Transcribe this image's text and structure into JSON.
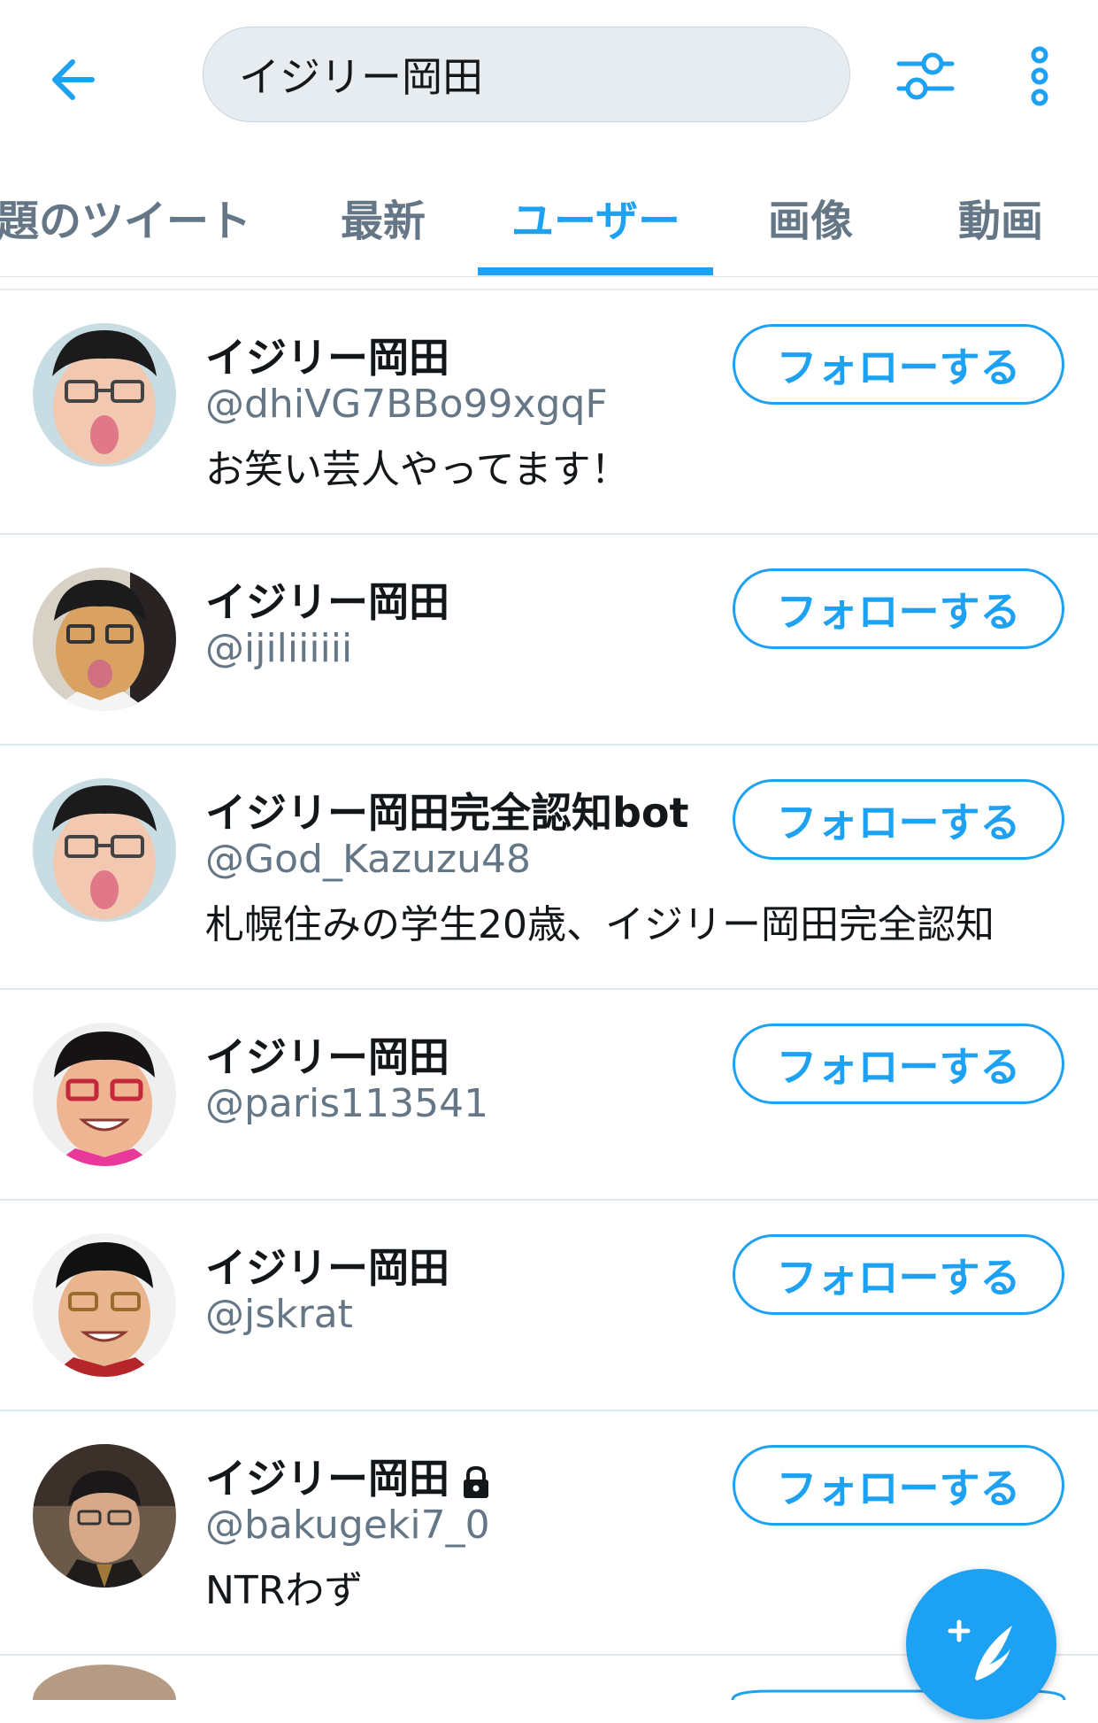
{
  "search": {
    "query": "イジリー岡田"
  },
  "icons": {
    "back": "arrow-left-icon",
    "filter": "sliders-icon",
    "more": "vertical-dots-icon",
    "compose": "compose-tweet-icon",
    "lock": "lock-icon"
  },
  "colors": {
    "accent": "#1da1f2",
    "secondary_text": "#657786",
    "divider": "#e1e8ed"
  },
  "tabs": [
    {
      "label": "題のツイート",
      "active": false
    },
    {
      "label": "最新",
      "active": false
    },
    {
      "label": "ユーザー",
      "active": true
    },
    {
      "label": "画像",
      "active": false
    },
    {
      "label": "動画",
      "active": false
    }
  ],
  "users": [
    {
      "name": "イジリー岡田",
      "handle": "@dhiVG7BBo99xgqF",
      "bio": "お笑い芸人やってます！",
      "follow_label": "フォローする",
      "protected": false
    },
    {
      "name": "イジリー岡田",
      "handle": "@ijiliiiiii",
      "bio": "",
      "follow_label": "フォローする",
      "protected": false
    },
    {
      "name": "イジリー岡田完全認知bot",
      "handle": "@God_Kazuzu48",
      "bio": "札幌住みの学生20歳、イジリー岡田完全認知",
      "follow_label": "フォローする",
      "protected": false
    },
    {
      "name": "イジリー岡田",
      "handle": "@paris113541",
      "bio": "",
      "follow_label": "フォローする",
      "protected": false
    },
    {
      "name": "イジリー岡田",
      "handle": "@jskrat",
      "bio": "",
      "follow_label": "フォローする",
      "protected": false
    },
    {
      "name": "イジリー岡田",
      "handle": "@bakugeki7_0",
      "bio": "NTRわず",
      "follow_label": "フォローする",
      "protected": true
    }
  ]
}
